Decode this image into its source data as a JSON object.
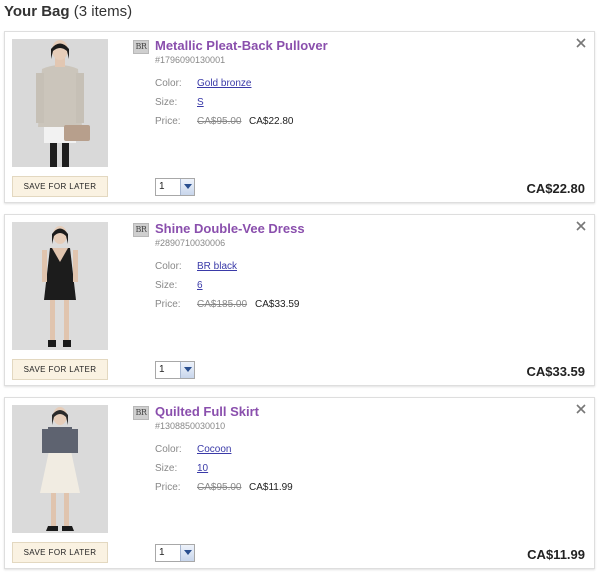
{
  "bag": {
    "title": "Your Bag",
    "count": "(3 items)"
  },
  "labels": {
    "color": "Color:",
    "size": "Size:",
    "price": "Price:",
    "save_for_later": "SAVE FOR LATER"
  },
  "brand_badge": "BR",
  "colors": {
    "product_link": "#8a4fad",
    "attribute_link": "#3a3aa8",
    "save_button": "#faf2e2"
  },
  "items": [
    {
      "name": "Metallic Pleat-Back Pullover",
      "sku": "#1796090130001",
      "color": "Gold bronze",
      "size": "S",
      "original_price": "CA$95.00",
      "sale_price": "CA$22.80",
      "quantity": "1",
      "total": "CA$22.80"
    },
    {
      "name": "Shine Double-Vee Dress",
      "sku": "#2890710030006",
      "color": "BR black",
      "size": "6",
      "original_price": "CA$185.00",
      "sale_price": "CA$33.59",
      "quantity": "1",
      "total": "CA$33.59"
    },
    {
      "name": "Quilted Full Skirt",
      "sku": "#1308850030010",
      "color": "Cocoon",
      "size": "10",
      "original_price": "CA$95.00",
      "sale_price": "CA$11.99",
      "quantity": "1",
      "total": "CA$11.99"
    }
  ]
}
